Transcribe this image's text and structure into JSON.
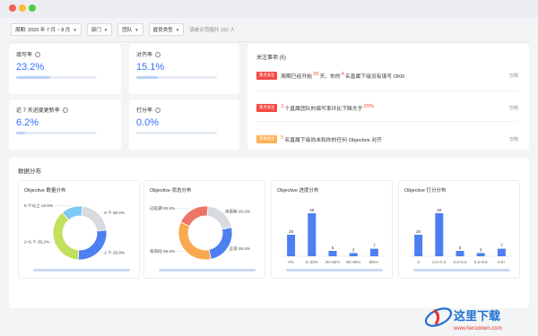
{
  "window": {
    "dots": [
      "#f25f58",
      "#fbbe3c",
      "#58c840"
    ]
  },
  "filters": {
    "period": "周期: 2020 年 7 月 ~ 8 月",
    "department": "部门",
    "team": "团队",
    "employee_type": "雇员类型",
    "scope": "该统计范围共 192 人"
  },
  "metrics": [
    {
      "label": "填写率",
      "value": "23.2%",
      "ratio": 0.232
    },
    {
      "label": "对齐率",
      "value": "15.1%",
      "ratio": 0.151
    },
    {
      "label": "近 7 天进度更新率",
      "value": "6.2%",
      "ratio": 0.062
    },
    {
      "label": "打分率",
      "value": "0.0%",
      "ratio": 0.0
    }
  ],
  "attention": {
    "title": "关注事项 (5)",
    "ignore_label": "忽略",
    "items": [
      {
        "tag": "重点关注",
        "tag_color": "#f54a45",
        "parts": [
          {
            "text": "周期已经开始",
            "hl": ""
          },
          {
            "text": "20",
            "hl": "r"
          },
          {
            "text": "天，你的",
            "hl": ""
          },
          {
            "text": "4",
            "hl": "r"
          },
          {
            "text": "名直属下级没有填写 OKR",
            "hl": ""
          }
        ]
      },
      {
        "tag": "重点关注",
        "tag_color": "#f54a45",
        "parts": [
          {
            "text": "2",
            "hl": "r"
          },
          {
            "text": "个直属团队的填写率环比下降大于",
            "hl": ""
          },
          {
            "text": "20%",
            "hl": "r"
          }
        ]
      },
      {
        "tag": "普通关注",
        "tag_color": "#ffb153",
        "parts": [
          {
            "text": "5",
            "hl": "o"
          },
          {
            "text": "名直属下级尚未和你的任何 Objective 对齐",
            "hl": ""
          }
        ]
      }
    ]
  },
  "section_title": "数据分布",
  "chart_data": [
    {
      "type": "pie",
      "title": "Objective 数量分布",
      "labels": [
        "0 个",
        "1 个",
        "2~5 个",
        "5 个以上"
      ],
      "label_texts": [
        "0 个 20.2%",
        "1 个 25.9%",
        "2~5 个 35.2%",
        "5 个以上 12.0%"
      ],
      "values": [
        20.2,
        25.9,
        35.2,
        12.0
      ],
      "colors": [
        "#d7dbe0",
        "#4e7ff0",
        "#c2e05e",
        "#7ec8f5"
      ]
    },
    {
      "type": "pie",
      "title": "Objective 状态分布",
      "labels": [
        "未更新",
        "正常",
        "有风险",
        "已延期"
      ],
      "label_texts": [
        "未更新 20.2%",
        "正常 25.2%",
        "有风险 35.2%",
        "已延期 20.2%"
      ],
      "values": [
        20.2,
        25.2,
        35.2,
        20.2
      ],
      "colors": [
        "#d7dbe0",
        "#4e7ff0",
        "#f8a94f",
        "#ee7468"
      ]
    },
    {
      "type": "bar",
      "title": "Objective 进度分布",
      "categories": [
        "0%",
        "0~30%",
        "30~60%",
        "60~90%",
        "90%+"
      ],
      "values": [
        20,
        40,
        5,
        3,
        7
      ],
      "ylim": [
        0,
        40
      ],
      "color": "#4e7ff0"
    },
    {
      "type": "bar",
      "title": "Objective 打分分布",
      "categories": [
        "0",
        "0.0~0.3",
        "0.3~0.6",
        "0.6~0.9",
        "0.9+"
      ],
      "values": [
        20,
        40,
        5,
        3,
        7
      ],
      "ylim": [
        0,
        40
      ],
      "color": "#4e7ff0"
    }
  ],
  "watermark": {
    "text": "这里下载",
    "url": "www.herodown.com",
    "colors": [
      "#1f6fd1",
      "#e8322f"
    ]
  }
}
